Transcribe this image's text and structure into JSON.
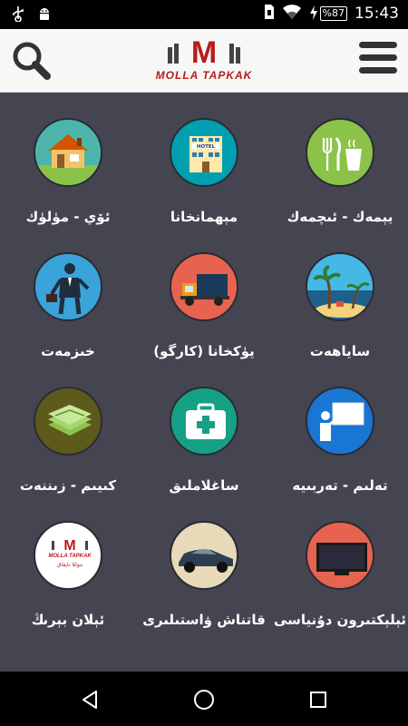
{
  "status_bar": {
    "time": "15:43",
    "battery": "%87",
    "icons": [
      "usb-icon",
      "android-icon",
      "sim-icon",
      "wifi-icon",
      "charging-icon"
    ]
  },
  "header": {
    "brand": "MOLLA TAPKAK",
    "logo_letter": "M",
    "brand_color": "#b71c1c"
  },
  "grid": [
    {
      "label": "يېمەك - ئىچمەك",
      "icon": "food-icon",
      "color": "#8bc34a"
    },
    {
      "label": "مېھمانخانا",
      "icon": "hotel-icon",
      "color": "#00a0b0",
      "icon_text": "HOTEL"
    },
    {
      "label": "ئۆي - مۈلۈك",
      "icon": "house-icon",
      "color": "#4db6ac"
    },
    {
      "label": "ساياھەت",
      "icon": "beach-icon",
      "color": "#2a7fb0"
    },
    {
      "label": "يۈكخانا (كارگو)",
      "icon": "truck-icon",
      "color": "#e8634f"
    },
    {
      "label": "خىزمەت",
      "icon": "businessman-icon",
      "color": "#3aa3d9"
    },
    {
      "label": "تەلىم - تەربىيە",
      "icon": "teacher-icon",
      "color": "#1976d2"
    },
    {
      "label": "ساغلاملىق",
      "icon": "first-aid-icon",
      "color": "#16a085"
    },
    {
      "label": "كىيىم - زىننەت",
      "icon": "clothes-icon",
      "color": "#5d5a1b"
    },
    {
      "label": "ئېلېكتىرون دۇنياسى",
      "icon": "tv-icon",
      "color": "#e8634f"
    },
    {
      "label": "قاتناش ۋاستىلىرى",
      "icon": "car-icon",
      "color": "#e8d9b8"
    },
    {
      "label": "ئېلان بېرىڭ",
      "icon": "brand-logo-icon",
      "color": "#ffffff",
      "icon_text": "MOLLA TAPKAK",
      "icon_subtext": "موللا تاپقاق"
    }
  ],
  "nav": {
    "icons": [
      "back-icon",
      "home-icon",
      "recents-icon"
    ]
  }
}
